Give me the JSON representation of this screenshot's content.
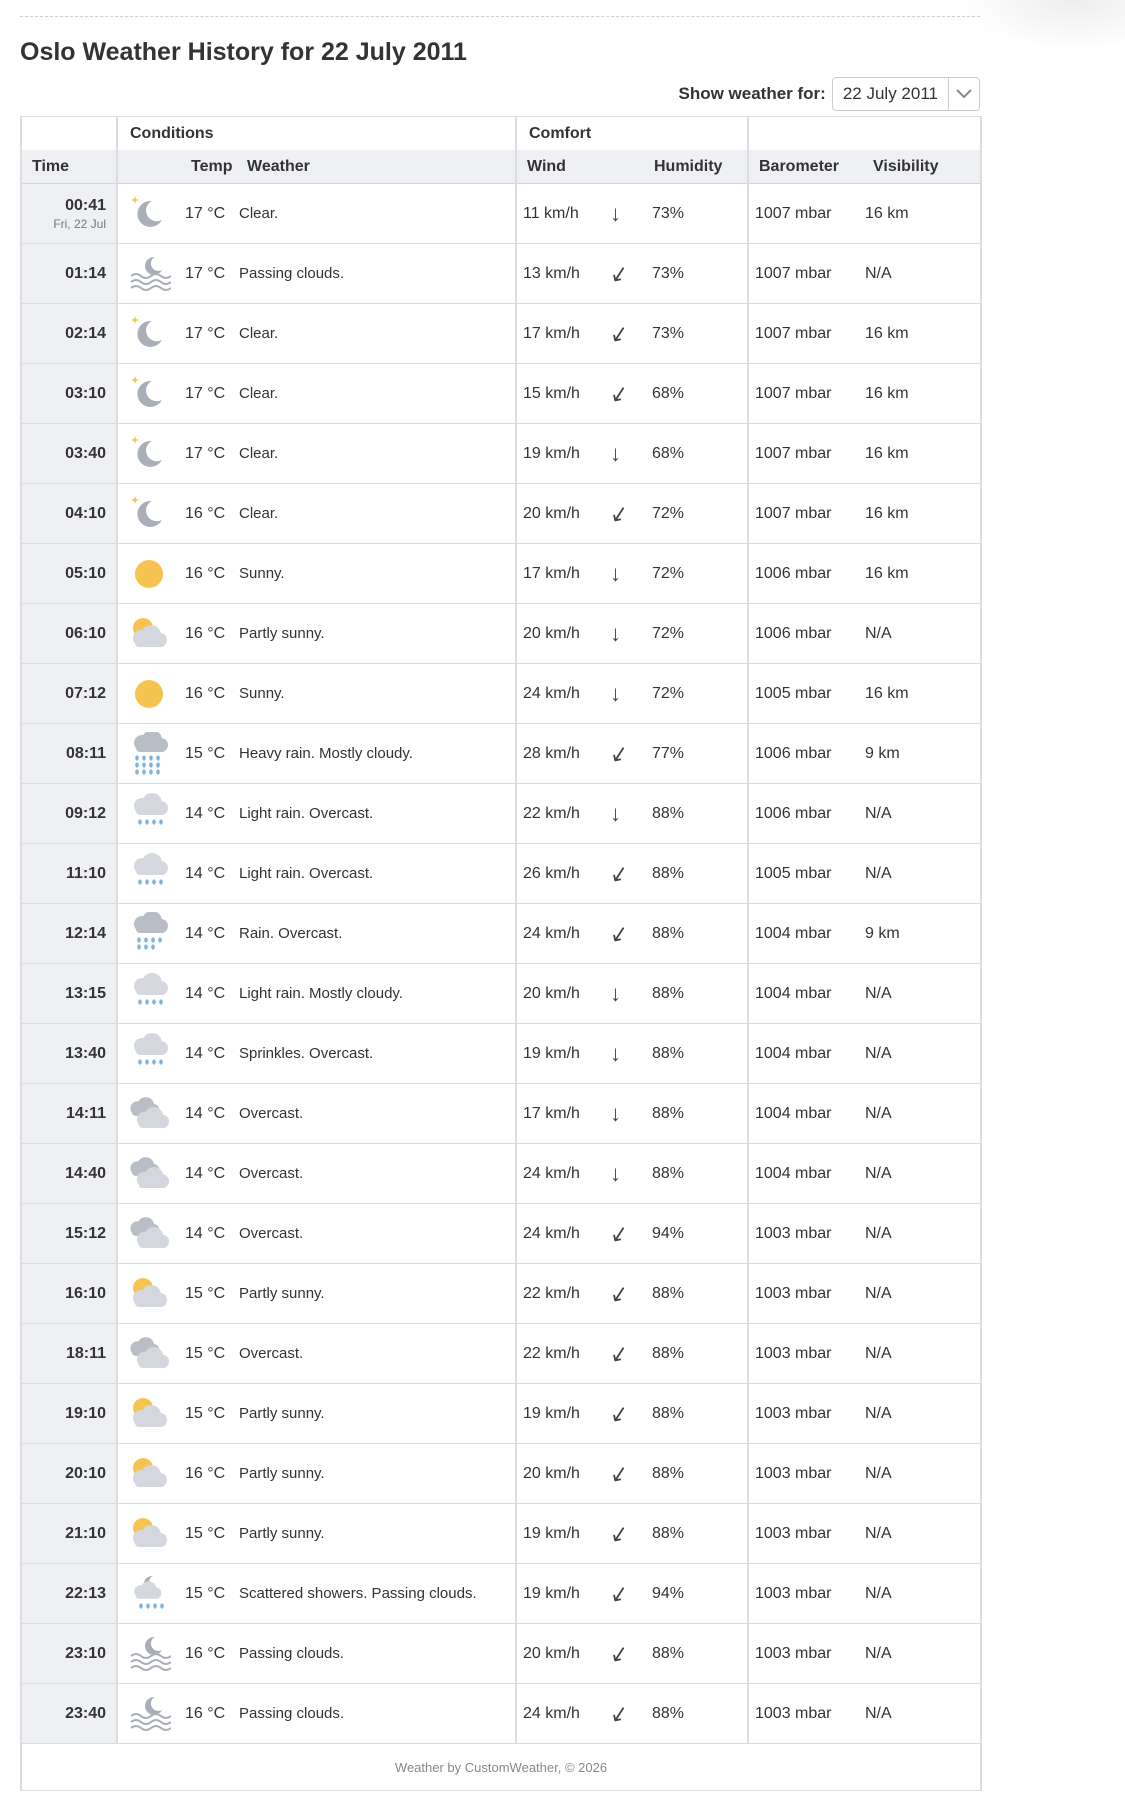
{
  "title": "Oslo Weather History for 22 July 2011",
  "picker": {
    "label": "Show weather for:",
    "value": "22 July 2011"
  },
  "groups": {
    "conditions": "Conditions",
    "comfort": "Comfort"
  },
  "columns": {
    "time": "Time",
    "temp": "Temp",
    "weather": "Weather",
    "wind": "Wind",
    "humidity": "Humidity",
    "barometer": "Barometer",
    "visibility": "Visibility"
  },
  "rows": [
    {
      "time": "00:41",
      "date": "Fri, 22 Jul",
      "icon": "moon-clear-icon",
      "temp": "17 °C",
      "weather": "Clear.",
      "wind": "11 km/h",
      "dir": "S",
      "humidity": "73%",
      "baro": "1007 mbar",
      "vis": "16 km"
    },
    {
      "time": "01:14",
      "date": "",
      "icon": "moon-fog-icon",
      "temp": "17 °C",
      "weather": "Passing clouds.",
      "wind": "13 km/h",
      "dir": "SW",
      "humidity": "73%",
      "baro": "1007 mbar",
      "vis": "N/A"
    },
    {
      "time": "02:14",
      "date": "",
      "icon": "moon-clear-icon",
      "temp": "17 °C",
      "weather": "Clear.",
      "wind": "17 km/h",
      "dir": "SW",
      "humidity": "73%",
      "baro": "1007 mbar",
      "vis": "16 km"
    },
    {
      "time": "03:10",
      "date": "",
      "icon": "moon-clear-icon",
      "temp": "17 °C",
      "weather": "Clear.",
      "wind": "15 km/h",
      "dir": "SW",
      "humidity": "68%",
      "baro": "1007 mbar",
      "vis": "16 km"
    },
    {
      "time": "03:40",
      "date": "",
      "icon": "moon-clear-icon",
      "temp": "17 °C",
      "weather": "Clear.",
      "wind": "19 km/h",
      "dir": "S",
      "humidity": "68%",
      "baro": "1007 mbar",
      "vis": "16 km"
    },
    {
      "time": "04:10",
      "date": "",
      "icon": "moon-clear-icon",
      "temp": "16 °C",
      "weather": "Clear.",
      "wind": "20 km/h",
      "dir": "SW",
      "humidity": "72%",
      "baro": "1007 mbar",
      "vis": "16 km"
    },
    {
      "time": "05:10",
      "date": "",
      "icon": "sun-icon",
      "temp": "16 °C",
      "weather": "Sunny.",
      "wind": "17 km/h",
      "dir": "S",
      "humidity": "72%",
      "baro": "1006 mbar",
      "vis": "16 km"
    },
    {
      "time": "06:10",
      "date": "",
      "icon": "partly-sunny-icon",
      "temp": "16 °C",
      "weather": "Partly sunny.",
      "wind": "20 km/h",
      "dir": "S",
      "humidity": "72%",
      "baro": "1006 mbar",
      "vis": "N/A"
    },
    {
      "time": "07:12",
      "date": "",
      "icon": "sun-icon",
      "temp": "16 °C",
      "weather": "Sunny.",
      "wind": "24 km/h",
      "dir": "S",
      "humidity": "72%",
      "baro": "1005 mbar",
      "vis": "16 km"
    },
    {
      "time": "08:11",
      "date": "",
      "icon": "heavy-rain-icon",
      "temp": "15 °C",
      "weather": "Heavy rain. Mostly cloudy.",
      "wind": "28 km/h",
      "dir": "SW",
      "humidity": "77%",
      "baro": "1006 mbar",
      "vis": "9 km"
    },
    {
      "time": "09:12",
      "date": "",
      "icon": "light-rain-icon",
      "temp": "14 °C",
      "weather": "Light rain. Overcast.",
      "wind": "22 km/h",
      "dir": "S",
      "humidity": "88%",
      "baro": "1006 mbar",
      "vis": "N/A"
    },
    {
      "time": "11:10",
      "date": "",
      "icon": "light-rain-icon",
      "temp": "14 °C",
      "weather": "Light rain. Overcast.",
      "wind": "26 km/h",
      "dir": "SW",
      "humidity": "88%",
      "baro": "1005 mbar",
      "vis": "N/A"
    },
    {
      "time": "12:14",
      "date": "",
      "icon": "rain-icon",
      "temp": "14 °C",
      "weather": "Rain. Overcast.",
      "wind": "24 km/h",
      "dir": "SW",
      "humidity": "88%",
      "baro": "1004 mbar",
      "vis": "9 km"
    },
    {
      "time": "13:15",
      "date": "",
      "icon": "light-rain-icon",
      "temp": "14 °C",
      "weather": "Light rain. Mostly cloudy.",
      "wind": "20 km/h",
      "dir": "S",
      "humidity": "88%",
      "baro": "1004 mbar",
      "vis": "N/A"
    },
    {
      "time": "13:40",
      "date": "",
      "icon": "light-rain-icon",
      "temp": "14 °C",
      "weather": "Sprinkles. Overcast.",
      "wind": "19 km/h",
      "dir": "S",
      "humidity": "88%",
      "baro": "1004 mbar",
      "vis": "N/A"
    },
    {
      "time": "14:11",
      "date": "",
      "icon": "overcast-icon",
      "temp": "14 °C",
      "weather": "Overcast.",
      "wind": "17 km/h",
      "dir": "S",
      "humidity": "88%",
      "baro": "1004 mbar",
      "vis": "N/A"
    },
    {
      "time": "14:40",
      "date": "",
      "icon": "overcast-icon",
      "temp": "14 °C",
      "weather": "Overcast.",
      "wind": "24 km/h",
      "dir": "S",
      "humidity": "88%",
      "baro": "1004 mbar",
      "vis": "N/A"
    },
    {
      "time": "15:12",
      "date": "",
      "icon": "overcast-icon",
      "temp": "14 °C",
      "weather": "Overcast.",
      "wind": "24 km/h",
      "dir": "SW",
      "humidity": "94%",
      "baro": "1003 mbar",
      "vis": "N/A"
    },
    {
      "time": "16:10",
      "date": "",
      "icon": "partly-sunny-icon",
      "temp": "15 °C",
      "weather": "Partly sunny.",
      "wind": "22 km/h",
      "dir": "SW",
      "humidity": "88%",
      "baro": "1003 mbar",
      "vis": "N/A"
    },
    {
      "time": "18:11",
      "date": "",
      "icon": "overcast-icon",
      "temp": "15 °C",
      "weather": "Overcast.",
      "wind": "22 km/h",
      "dir": "SW",
      "humidity": "88%",
      "baro": "1003 mbar",
      "vis": "N/A"
    },
    {
      "time": "19:10",
      "date": "",
      "icon": "partly-sunny-icon",
      "temp": "15 °C",
      "weather": "Partly sunny.",
      "wind": "19 km/h",
      "dir": "SW",
      "humidity": "88%",
      "baro": "1003 mbar",
      "vis": "N/A"
    },
    {
      "time": "20:10",
      "date": "",
      "icon": "partly-sunny-icon",
      "temp": "16 °C",
      "weather": "Partly sunny.",
      "wind": "20 km/h",
      "dir": "SW",
      "humidity": "88%",
      "baro": "1003 mbar",
      "vis": "N/A"
    },
    {
      "time": "21:10",
      "date": "",
      "icon": "partly-sunny-icon",
      "temp": "15 °C",
      "weather": "Partly sunny.",
      "wind": "19 km/h",
      "dir": "SW",
      "humidity": "88%",
      "baro": "1003 mbar",
      "vis": "N/A"
    },
    {
      "time": "22:13",
      "date": "",
      "icon": "moon-showers-icon",
      "temp": "15 °C",
      "weather": "Scattered showers. Passing clouds.",
      "wind": "19 km/h",
      "dir": "SW",
      "humidity": "94%",
      "baro": "1003 mbar",
      "vis": "N/A"
    },
    {
      "time": "23:10",
      "date": "",
      "icon": "moon-fog-icon",
      "temp": "16 °C",
      "weather": "Passing clouds.",
      "wind": "20 km/h",
      "dir": "SW",
      "humidity": "88%",
      "baro": "1003 mbar",
      "vis": "N/A"
    },
    {
      "time": "23:40",
      "date": "",
      "icon": "moon-fog-icon",
      "temp": "16 °C",
      "weather": "Passing clouds.",
      "wind": "24 km/h",
      "dir": "SW",
      "humidity": "88%",
      "baro": "1003 mbar",
      "vis": "N/A"
    }
  ],
  "footer": "Weather by CustomWeather, © 2026",
  "colors": {
    "sun": "#f5c350",
    "moon": "#a9aeb8",
    "cloud": "#d4d7dd",
    "rain": "#7fb3de",
    "header_bg": "#eef0f3"
  }
}
